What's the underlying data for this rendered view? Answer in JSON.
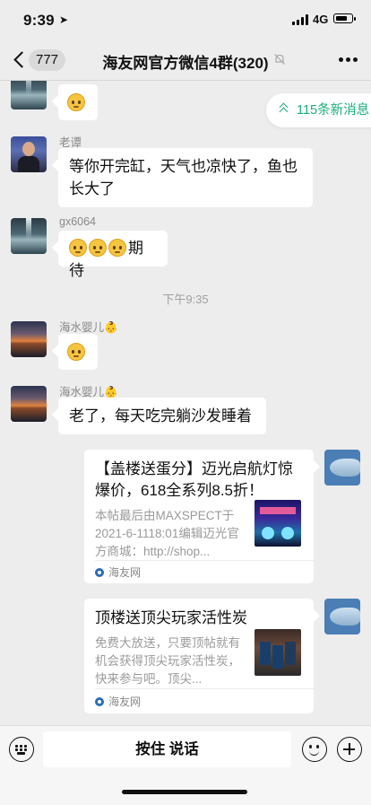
{
  "status_bar": {
    "time": "9:39",
    "network": "4G"
  },
  "nav": {
    "unread_count": "777",
    "title": "海友网官方微信4群(320)"
  },
  "new_messages": {
    "label": "115条新消息"
  },
  "messages": [
    {
      "sender": "老谭",
      "text": "等你开完缸，天气也凉快了，鱼也长大了"
    },
    {
      "sender": "gx6064",
      "text": "期待"
    },
    {
      "timestamp": "下午9:35"
    },
    {
      "sender": "海水婴儿👶"
    },
    {
      "sender": "海水婴儿👶",
      "text": "老了，每天吃完躺沙发睡着"
    }
  ],
  "cards": [
    {
      "title": "【盖楼送蛋分】迈光启航灯惊爆价，618全系列8.5折！",
      "description": "本帖最后由MAXSPECT于2021-6-1118:01编辑迈光官方商城：http://shop...",
      "source": "海友网"
    },
    {
      "title": "顶楼送顶尖玩家活性炭",
      "description": "免费大放送，只要顶帖就有机会获得顶尖玩家活性炭，快来参与吧。顶尖...",
      "source": "海友网"
    }
  ],
  "input_bar": {
    "hold_to_talk": "按住 说话"
  }
}
